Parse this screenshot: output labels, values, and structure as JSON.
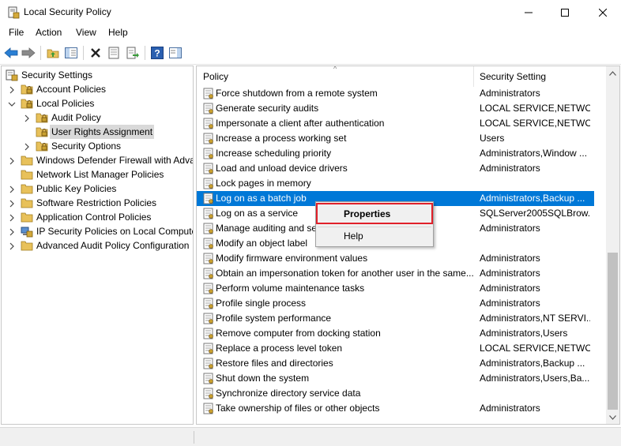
{
  "window": {
    "title": "Local Security Policy"
  },
  "menu": {
    "items": [
      "File",
      "Action",
      "View",
      "Help"
    ]
  },
  "toolbar": {
    "icons": [
      "back-arrow",
      "forward-arrow",
      "up-folder",
      "show-hide-tree",
      "delete",
      "properties",
      "export-list",
      "help",
      "show-hide-action-pane"
    ]
  },
  "tree": {
    "items": [
      {
        "label": "Security Settings",
        "icon": "security-settings-icon",
        "expanded": true
      },
      {
        "label": "Account Policies",
        "icon": "folder-lock-icon",
        "expanded": false
      },
      {
        "label": "Local Policies",
        "icon": "folder-lock-icon",
        "expanded": true
      },
      {
        "label": "Audit Policy",
        "icon": "folder-lock-icon",
        "expanded": false
      },
      {
        "label": "User Rights Assignment",
        "icon": "folder-lock-icon",
        "selected": true
      },
      {
        "label": "Security Options",
        "icon": "folder-lock-icon",
        "expanded": false
      },
      {
        "label": "Windows Defender Firewall with Adva",
        "icon": "folder-icon",
        "expanded": false
      },
      {
        "label": "Network List Manager Policies",
        "icon": "folder-icon"
      },
      {
        "label": "Public Key Policies",
        "icon": "folder-icon",
        "expanded": false
      },
      {
        "label": "Software Restriction Policies",
        "icon": "folder-icon",
        "expanded": false
      },
      {
        "label": "Application Control Policies",
        "icon": "folder-icon",
        "expanded": false
      },
      {
        "label": "IP Security Policies on Local Compute",
        "icon": "ip-security-icon",
        "expanded": false
      },
      {
        "label": "Advanced Audit Policy Configuration",
        "icon": "folder-icon",
        "expanded": false
      }
    ]
  },
  "list": {
    "columns": {
      "policy": "Policy",
      "setting": "Security Setting"
    },
    "rows": [
      {
        "policy": "Force shutdown from a remote system",
        "setting": "Administrators"
      },
      {
        "policy": "Generate security audits",
        "setting": "LOCAL SERVICE,NETWO..."
      },
      {
        "policy": "Impersonate a client after authentication",
        "setting": "LOCAL SERVICE,NETWO..."
      },
      {
        "policy": "Increase a process working set",
        "setting": "Users"
      },
      {
        "policy": "Increase scheduling priority",
        "setting": "Administrators,Window ..."
      },
      {
        "policy": "Load and unload device drivers",
        "setting": "Administrators"
      },
      {
        "policy": "Lock pages in memory",
        "setting": ""
      },
      {
        "policy": "Log on as a batch job",
        "setting": "Administrators,Backup ...",
        "selected": true
      },
      {
        "policy": "Log on as a service",
        "setting": "SQLServer2005SQLBrow..."
      },
      {
        "policy": "Manage auditing and se",
        "setting": "Administrators"
      },
      {
        "policy": "Modify an object label",
        "setting": ""
      },
      {
        "policy": "Modify firmware environment values",
        "setting": "Administrators"
      },
      {
        "policy": "Obtain an impersonation token for another user in the same...",
        "setting": "Administrators"
      },
      {
        "policy": "Perform volume maintenance tasks",
        "setting": "Administrators"
      },
      {
        "policy": "Profile single process",
        "setting": "Administrators"
      },
      {
        "policy": "Profile system performance",
        "setting": "Administrators,NT SERVI..."
      },
      {
        "policy": "Remove computer from docking station",
        "setting": "Administrators,Users"
      },
      {
        "policy": "Replace a process level token",
        "setting": "LOCAL SERVICE,NETWO..."
      },
      {
        "policy": "Restore files and directories",
        "setting": "Administrators,Backup ..."
      },
      {
        "policy": "Shut down the system",
        "setting": "Administrators,Users,Ba..."
      },
      {
        "policy": "Synchronize directory service data",
        "setting": ""
      },
      {
        "policy": "Take ownership of files or other objects",
        "setting": "Administrators"
      }
    ]
  },
  "context_menu": {
    "items": [
      "Properties",
      "Help"
    ],
    "highlighted": "Properties"
  },
  "colors": {
    "selection": "#0078d7",
    "highlight_box": "#e0202a",
    "folder": "#e8c15a"
  }
}
